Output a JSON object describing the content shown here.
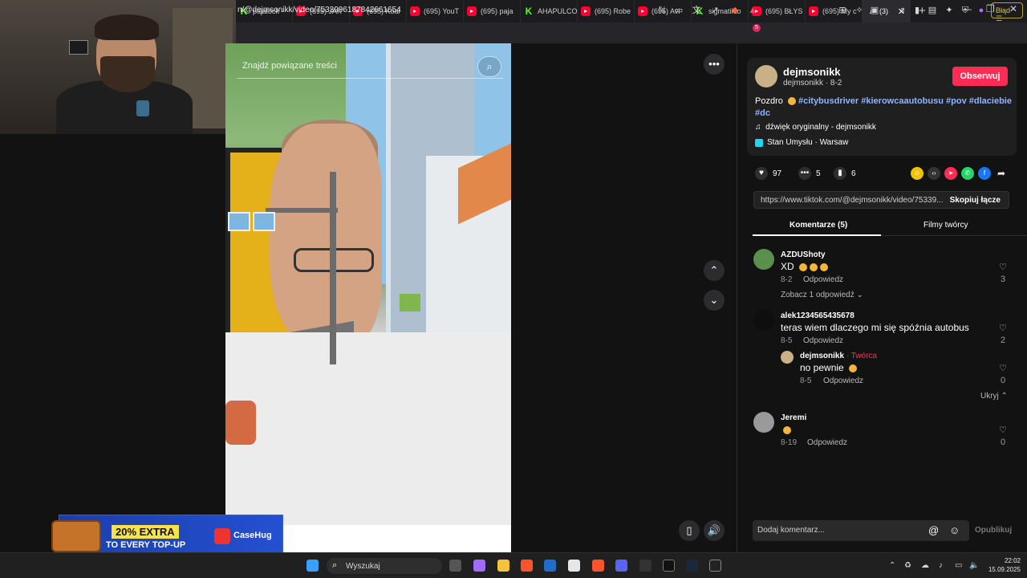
{
  "browser": {
    "tabs": [
      {
        "label": "pajalock -",
        "type": "kick"
      },
      {
        "label": "(695) JAK",
        "type": "yt"
      },
      {
        "label": "(695) Koal",
        "type": "yt"
      },
      {
        "label": "(695) YouT",
        "type": "yt"
      },
      {
        "label": "(695) paja",
        "type": "yt"
      },
      {
        "label": "AHAPULCO",
        "type": "kick"
      },
      {
        "label": "(695) Robe",
        "type": "yt"
      },
      {
        "label": "(695) Avi",
        "type": "yt"
      },
      {
        "label": "sigmatikto",
        "type": "kick"
      },
      {
        "label": "(695) BŁYS",
        "type": "yt"
      },
      {
        "label": "(695) My c",
        "type": "yt"
      },
      {
        "label": "(3)",
        "type": "tiktok"
      }
    ],
    "url": "n/@dejmsonikk/video/7533996187842661654",
    "error_button": "Błąd",
    "notification_count": "5"
  },
  "video": {
    "search_placeholder": "Znajdź powiązane treści"
  },
  "ad": {
    "headline": "20% EXTRA",
    "subline": "TO EVERY TOP-UP",
    "brand": "CaseHug"
  },
  "post": {
    "username": "dejmsonikk",
    "subline": "dejmsonikk · 8-2",
    "follow_label": "Obserwuj",
    "desc_prefix": "Pozdro",
    "hashtags": [
      "#citybusdriver",
      "#kierowcaautobusu",
      "#pov",
      "#dlaciebie",
      "#dc"
    ],
    "music": "dźwięk oryginalny - dejmsonikk",
    "location": "Stan Umysłu · Warsaw",
    "likes": "97",
    "comments": "5",
    "saves": "6",
    "link": "https://www.tiktok.com/@dejmsonikk/video/75339...",
    "copy_label": "Skopiuj łącze"
  },
  "tabs2": {
    "comments": "Komentarze (5)",
    "creator_videos": "Filmy twórcy"
  },
  "comments": [
    {
      "user": "AZDUShoty",
      "text": "XD",
      "date": "8-2",
      "reply": "Odpowiedz",
      "likes": "3",
      "more": "Zobacz 1 odpowiedź"
    },
    {
      "user": "alek1234565435678",
      "text": "teras wiem dlaczego mi się spóźnia autobus",
      "date": "8-5",
      "reply": "Odpowiedz",
      "likes": "2"
    },
    {
      "user": "dejmsonikk",
      "creator_label": " · Twórca",
      "text": "no pewnie",
      "date": "8-5",
      "reply": "Odpowiedz",
      "likes": "0",
      "collapse": "Ukryj"
    },
    {
      "user": "Jeremi",
      "text": "",
      "date": "8-19",
      "reply": "Odpowiedz",
      "likes": "0"
    }
  ],
  "composer": {
    "placeholder": "Dodaj komentarz...",
    "publish": "Opublikuj"
  },
  "taskbar": {
    "search": "Wyszukaj",
    "time": "22:02",
    "date": "15.09.2025"
  }
}
